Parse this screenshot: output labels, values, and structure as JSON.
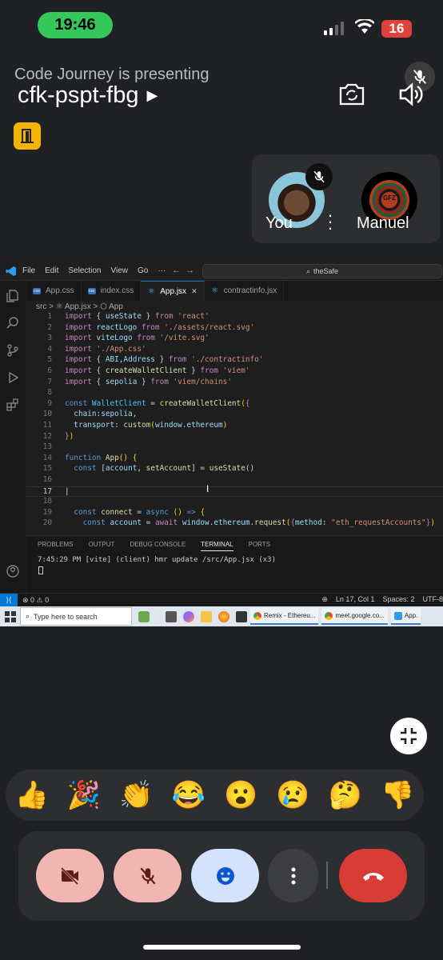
{
  "status_bar": {
    "time": "19:46",
    "battery": "16"
  },
  "meeting": {
    "presenter_text": "Code Journey is presenting",
    "code": "cfk-pspt-fbg"
  },
  "participants": [
    {
      "label": "You"
    },
    {
      "label": "Manuel",
      "avatar_text": "GFZ"
    }
  ],
  "vscode": {
    "menu": [
      "File",
      "Edit",
      "Selection",
      "View",
      "Go",
      "···"
    ],
    "search": "theSafe",
    "tabs": [
      {
        "label": "App.css",
        "icon": "css"
      },
      {
        "label": "index.css",
        "icon": "css"
      },
      {
        "label": "App.jsx",
        "icon": "react",
        "active": true,
        "close": "✕"
      },
      {
        "label": "contractinfo.jsx",
        "icon": "react"
      }
    ],
    "breadcrumb": "src > ⚛ App.jsx > ⬡ App",
    "code_lines": [
      {
        "n": "1",
        "text": "import { useState } from 'react'"
      },
      {
        "n": "2",
        "text": "import reactLogo from './assets/react.svg'"
      },
      {
        "n": "3",
        "text": "import viteLogo from '/vite.svg'"
      },
      {
        "n": "4",
        "text": "import './App.css'"
      },
      {
        "n": "5",
        "text": "import { ABI,Address } from './contractinfo'"
      },
      {
        "n": "6",
        "text": "import { createWalletClient } from 'viem'"
      },
      {
        "n": "7",
        "text": "import { sepolia } from 'viem/chains'"
      },
      {
        "n": "8",
        "text": ""
      },
      {
        "n": "9",
        "text": "const WalletClient = createWalletClient({"
      },
      {
        "n": "10",
        "text": "  chain:sepolia,"
      },
      {
        "n": "11",
        "text": "  transport: custom(window.ethereum)"
      },
      {
        "n": "12",
        "text": "})"
      },
      {
        "n": "13",
        "text": ""
      },
      {
        "n": "14",
        "text": "function App() {"
      },
      {
        "n": "15",
        "text": "  const [account, setAccount] = useState()"
      },
      {
        "n": "16",
        "text": ""
      },
      {
        "n": "17",
        "text": ""
      },
      {
        "n": "18",
        "text": ""
      },
      {
        "n": "19",
        "text": "  const connect = async () => {"
      },
      {
        "n": "20",
        "text": "    const account = await window.ethereum.request({method: \"eth_requestAccounts\"})"
      }
    ],
    "panel_tabs": [
      "PROBLEMS",
      "OUTPUT",
      "DEBUG CONSOLE",
      "TERMINAL",
      "PORTS"
    ],
    "terminal_line": "7:45:29 PM [vite] (client) hmr update /src/App.jsx (x3)",
    "status_left": "⊗ 0 ⚠ 0",
    "status_right": [
      "Ln 17, Col 1",
      "Spaces: 2",
      "UTF-8"
    ],
    "taskbar": {
      "search_placeholder": "Type here to search",
      "apps": [
        "Remix - Ethereu...",
        "meet.google.co...",
        "App."
      ]
    }
  },
  "reactions": [
    "👍",
    "🎉",
    "👏",
    "😂",
    "😮",
    "😢",
    "🤔",
    "👎"
  ],
  "colors": {
    "accent_green": "#34c759",
    "hangup": "#d93c35",
    "muted": "#f1b6b2",
    "emoji_btn": "#d3e3fd"
  }
}
